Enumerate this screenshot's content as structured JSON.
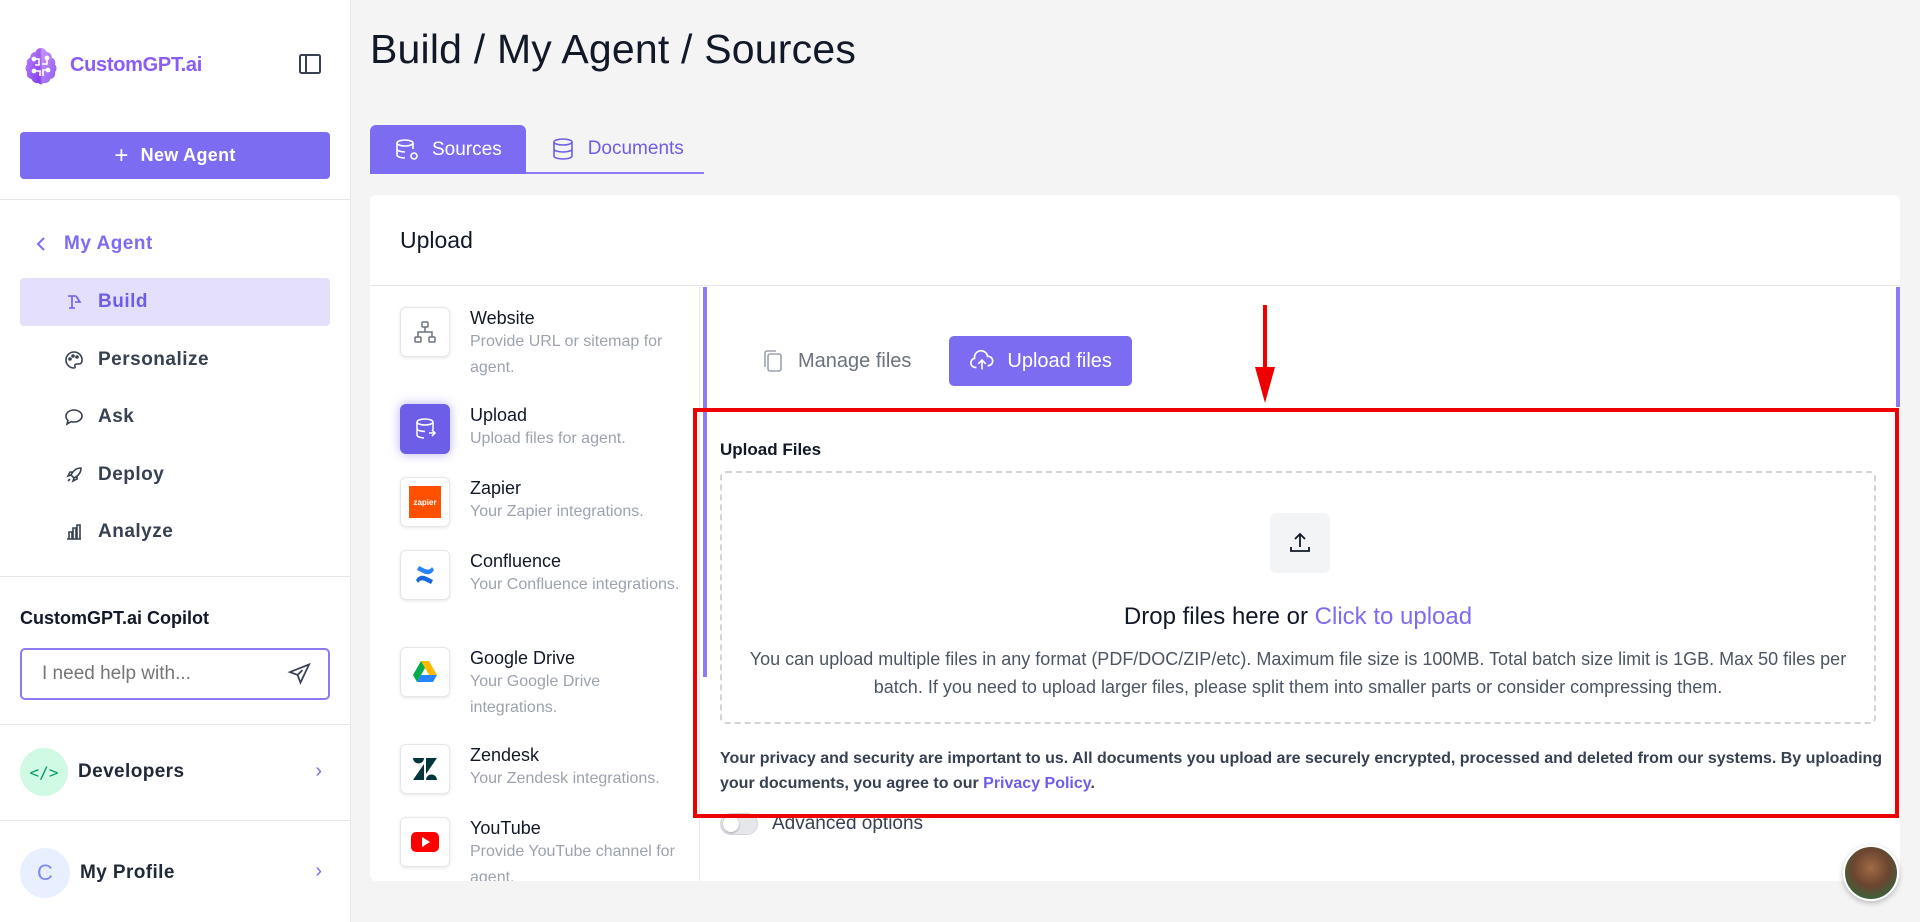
{
  "sidebar": {
    "brand": "CustomGPT.ai",
    "new_agent_label": "New Agent",
    "back_label": "My Agent",
    "nav": [
      {
        "label": "Build",
        "icon": "build-icon",
        "active": true
      },
      {
        "label": "Personalize",
        "icon": "palette-icon",
        "active": false
      },
      {
        "label": "Ask",
        "icon": "chat-icon",
        "active": false
      },
      {
        "label": "Deploy",
        "icon": "rocket-icon",
        "active": false
      },
      {
        "label": "Analyze",
        "icon": "bar-chart-icon",
        "active": false
      }
    ],
    "copilot_title": "CustomGPT.ai Copilot",
    "copilot_placeholder": "I need help with...",
    "developers_label": "Developers",
    "developers_icon_text": "</>",
    "profile_label": "My Profile",
    "profile_initial": "C"
  },
  "main": {
    "title": "Build / My Agent / Sources",
    "tabs": [
      {
        "label": "Sources",
        "active": true
      },
      {
        "label": "Documents",
        "active": false
      }
    ],
    "card_title": "Upload",
    "sources": [
      {
        "name": "Website",
        "desc": "Provide URL or sitemap for agent.",
        "icon": "sitemap-icon"
      },
      {
        "name": "Upload",
        "desc": "Upload files for agent.",
        "icon": "upload-database-icon",
        "active": true
      },
      {
        "name": "Zapier",
        "desc": "Your Zapier integrations.",
        "icon": "zapier-icon",
        "icon_text": "zapier"
      },
      {
        "name": "Confluence",
        "desc": "Your Confluence integrations.",
        "icon": "confluence-icon"
      },
      {
        "name": "Google Drive",
        "desc": "Your Google Drive integrations.",
        "icon": "google-drive-icon"
      },
      {
        "name": "Zendesk",
        "desc": "Your Zendesk integrations.",
        "icon": "zendesk-icon"
      },
      {
        "name": "YouTube",
        "desc": "Provide YouTube channel for agent.",
        "icon": "youtube-icon"
      }
    ],
    "mode_buttons": {
      "manage_label": "Manage files",
      "upload_label": "Upload files"
    },
    "upload": {
      "label": "Upload Files",
      "drop_text": "Drop files here or ",
      "click_text": "Click to upload",
      "help_text": "You can upload multiple files in any format (PDF/DOC/ZIP/etc). Maximum file size is 100MB. Total batch size limit is 1GB. Max 50 files per batch. If you need to upload larger files, please split them into smaller parts or consider compressing them.",
      "privacy_text": "Your privacy and security are important to us. All documents you upload are securely encrypted, processed and deleted from our systems. By uploading your documents, you agree to our ",
      "privacy_link": "Privacy Policy",
      "privacy_end": "."
    },
    "advanced_label": "Advanced options"
  },
  "colors": {
    "accent": "#7c6cf2",
    "accent_light": "#e4e0fc",
    "highlight": "#ef0000"
  }
}
